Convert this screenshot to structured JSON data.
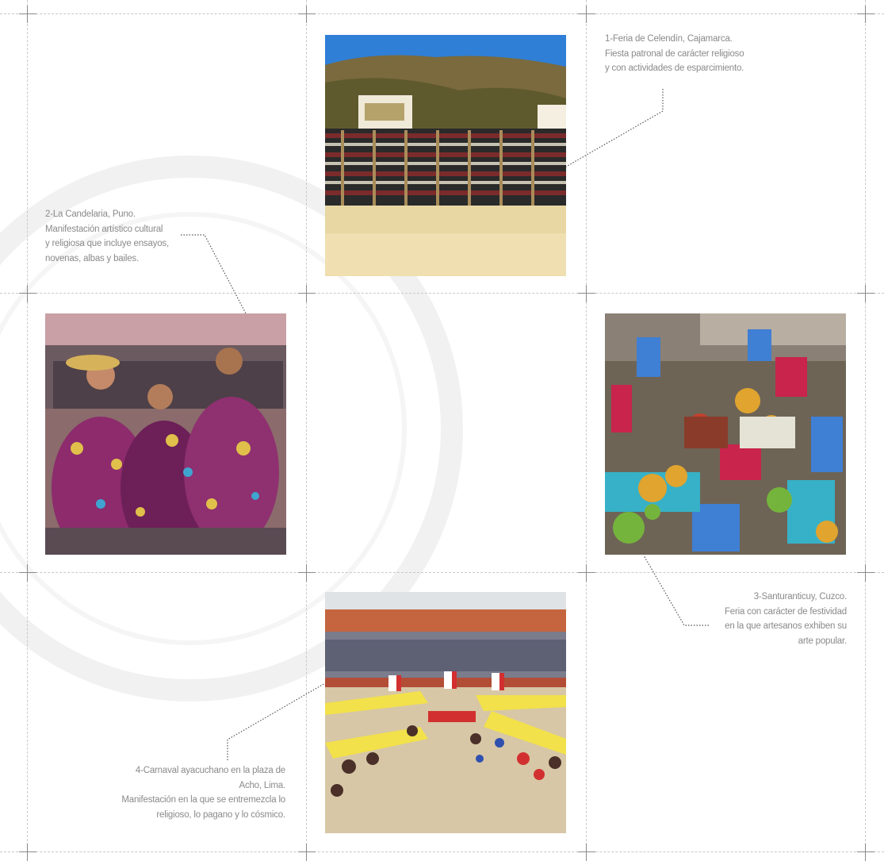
{
  "captions": {
    "c1": {
      "line1": "1-Feria de Celendín, Cajamarca.",
      "line2": "Fiesta patronal de carácter religioso",
      "line3": "y con actividades de esparcimiento."
    },
    "c2": {
      "line1": "2-La Candelaria, Puno.",
      "line2": "Manifestación artístico cultural",
      "line3": "y religiosa que incluye ensayos,",
      "line4": "novenas, albas y bailes."
    },
    "c3": {
      "line1": "3-Santuranticuy, Cuzco.",
      "line2": "Feria con carácter de festividad",
      "line3": "en la que artesanos exhiben su",
      "line4": "arte popular."
    },
    "c4": {
      "line1": "4-Carnaval ayacuchano en la plaza de",
      "line2": "Acho, Lima.",
      "line3": "Manifestación en la que se entremezcla lo",
      "line4": "religioso, lo pagano y lo cósmico."
    }
  },
  "colors": {
    "grid": "#c8c8c8",
    "caption_text": "#8a8a8a",
    "leader": "#555555"
  }
}
